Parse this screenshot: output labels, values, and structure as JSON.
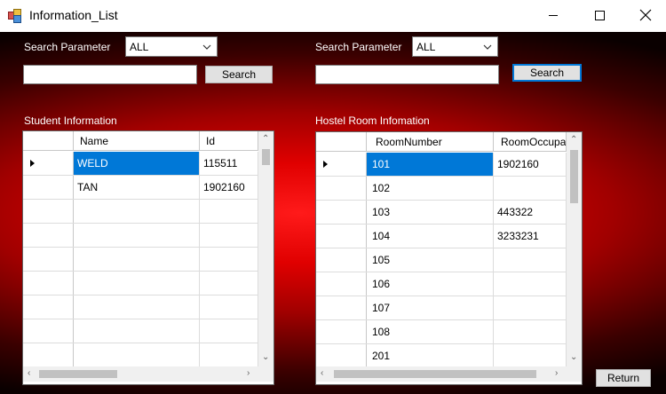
{
  "window": {
    "title": "Information_List",
    "icon": "app-form-icon"
  },
  "left": {
    "search_label": "Search Parameter",
    "combo_value": "ALL",
    "search_text": "",
    "search_button": "Search",
    "section_label": "Student Information",
    "grid": {
      "columns": [
        "Name",
        "Id"
      ],
      "rows": [
        [
          "WELD",
          "115511"
        ],
        [
          "TAN",
          "1902160"
        ],
        [
          "",
          ""
        ],
        [
          "",
          ""
        ],
        [
          "",
          ""
        ],
        [
          "",
          ""
        ],
        [
          "",
          ""
        ],
        [
          "",
          ""
        ],
        [
          "",
          ""
        ]
      ]
    }
  },
  "right": {
    "search_label": "Search Parameter",
    "combo_value": "ALL",
    "search_text": "",
    "search_button": "Search",
    "section_label": "Hostel Room Infomation",
    "grid": {
      "columns": [
        "RoomNumber",
        "RoomOccupa"
      ],
      "rows": [
        [
          "101",
          "1902160"
        ],
        [
          "102",
          ""
        ],
        [
          "103",
          "443322"
        ],
        [
          "104",
          "3233231"
        ],
        [
          "105",
          ""
        ],
        [
          "106",
          ""
        ],
        [
          "107",
          ""
        ],
        [
          "108",
          ""
        ],
        [
          "201",
          ""
        ]
      ]
    }
  },
  "return_button": "Return"
}
